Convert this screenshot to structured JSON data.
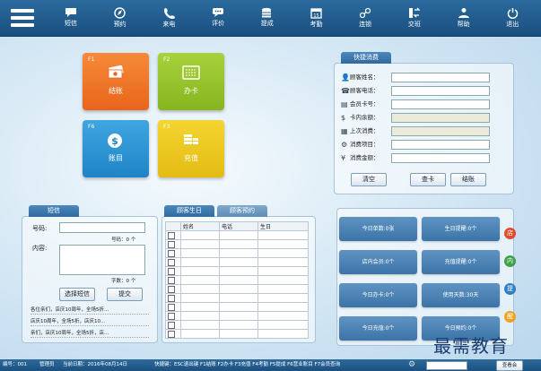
{
  "nav": [
    {
      "label": "短信",
      "icon": "message-icon"
    },
    {
      "label": "预约",
      "icon": "compass-icon"
    },
    {
      "label": "来电",
      "icon": "phone-icon"
    },
    {
      "label": "评价",
      "icon": "comment-icon"
    },
    {
      "label": "提成",
      "icon": "coins-icon"
    },
    {
      "label": "考勤",
      "icon": "calendar-icon"
    },
    {
      "label": "连锁",
      "icon": "chain-icon"
    },
    {
      "label": "交班",
      "icon": "swap-icon"
    },
    {
      "label": "帮助",
      "icon": "help-icon"
    },
    {
      "label": "退出",
      "icon": "power-icon"
    }
  ],
  "tiles": [
    {
      "key": "F1",
      "label": "结账",
      "icon": "money-icon",
      "color": "#f0772b"
    },
    {
      "key": "F2",
      "label": "办卡",
      "icon": "card-icon",
      "color": "#96c42c"
    },
    {
      "key": "F6",
      "label": "账目",
      "icon": "dollar-icon",
      "color": "#2f95d6"
    },
    {
      "key": "F3",
      "label": "充值",
      "icon": "coin-stack-icon",
      "color": "#ecc91f"
    }
  ],
  "quick": {
    "title": "快捷消费",
    "fields": [
      {
        "label": "顾客姓名：",
        "icon": "person-icon",
        "readonly": false
      },
      {
        "label": "顾客电话：",
        "icon": "phone-icon",
        "readonly": false
      },
      {
        "label": "会员卡号：",
        "icon": "card-icon",
        "readonly": false
      },
      {
        "label": "卡内余额：",
        "icon": "dollar-icon",
        "readonly": true
      },
      {
        "label": "上次消费：",
        "icon": "calendar-icon",
        "readonly": true
      },
      {
        "label": "消费项目：",
        "icon": "gear-icon",
        "readonly": false
      },
      {
        "label": "消费金额：",
        "icon": "yen-icon",
        "readonly": false
      }
    ],
    "buttons": [
      "清空",
      "查卡",
      "结账"
    ]
  },
  "sms": {
    "title": "短信",
    "phone_label": "号码:",
    "phone_count": "号码：0 个",
    "content_label": "内容:",
    "char_count": "字数：0 个",
    "select_btn": "选择短信",
    "submit_btn": "提交",
    "templates": [
      "各位亲们，店庆10周年，全场5折...",
      "店庆10周年，全场5折，店庆10...",
      "亲们，店庆10周年，全场5折，店..."
    ]
  },
  "customer": {
    "tabs": [
      "顾客生日",
      "顾客预约"
    ],
    "columns": [
      "姓名",
      "电话",
      "生日"
    ],
    "row_count": 12
  },
  "stats": [
    "今日单数:0张",
    "生日提醒:0个",
    "店内会员:0个",
    "充值提醒:0个",
    "今日办卡:0个",
    "使用天数:30天",
    "今日充值:0个",
    "今日预约:0个"
  ],
  "side_badges": [
    {
      "text": "店",
      "color": "#e24b2b"
    },
    {
      "text": "内",
      "color": "#3fa14b"
    },
    {
      "text": "提",
      "color": "#2f7ec4"
    },
    {
      "text": "醒",
      "color": "#f0a020"
    }
  ],
  "status": {
    "id": "编号：001",
    "operator": "管理员",
    "date": "当前日期：2016年08月14日",
    "shortcuts": "快捷键：ESC退出键 F1结账 F2办卡 F3充值 F4考勤 F5提成 F6营业账目 F7会员查询",
    "search_button": "查看会"
  },
  "watermark": "最需教育",
  "colors": {
    "topbar": "#1f5a8c",
    "accent": "#3c74a8"
  }
}
